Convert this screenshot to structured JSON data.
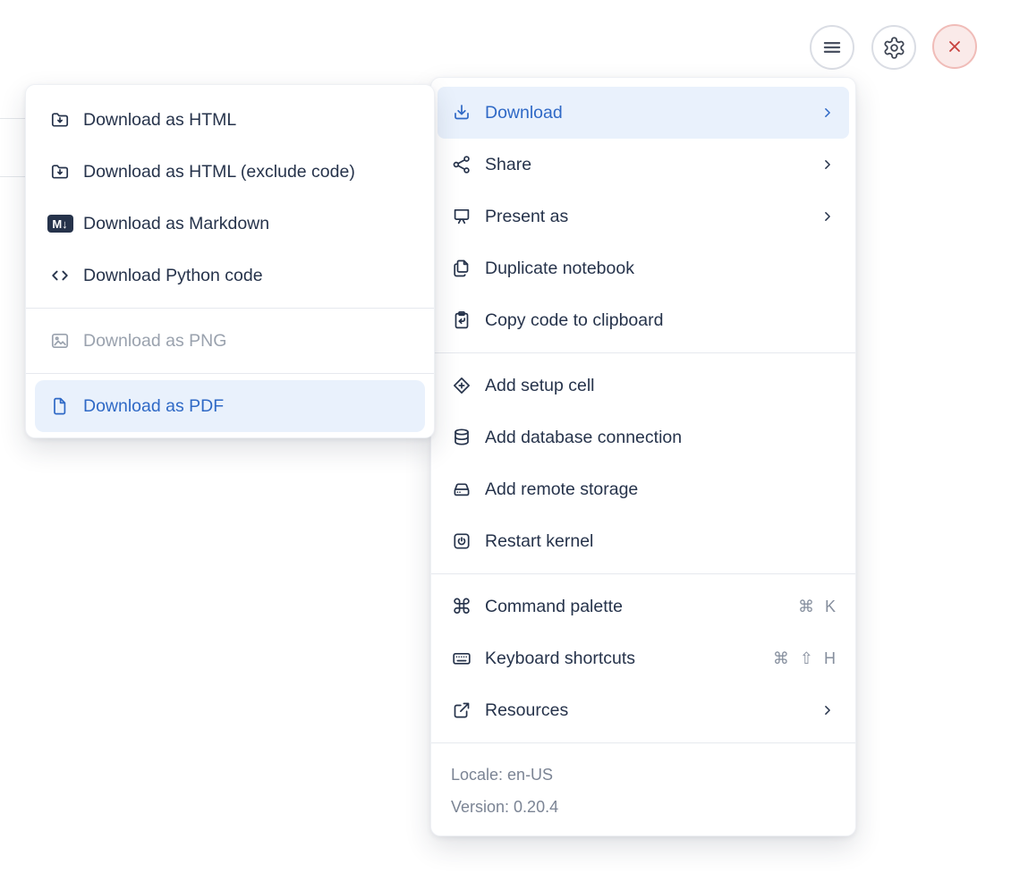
{
  "toolbar": {
    "buttons": [
      {
        "name": "hamburger-menu-button",
        "icon": "hamburger-icon"
      },
      {
        "name": "settings-button",
        "icon": "gear-icon"
      },
      {
        "name": "close-button",
        "icon": "close-icon"
      }
    ]
  },
  "main_menu": {
    "groups": [
      {
        "items": [
          {
            "label": "Download",
            "icon": "download-icon",
            "chevron": true,
            "highlighted": true
          },
          {
            "label": "Share",
            "icon": "share-icon",
            "chevron": true
          },
          {
            "label": "Present as",
            "icon": "presentation-icon",
            "chevron": true
          },
          {
            "label": "Duplicate notebook",
            "icon": "duplicate-icon"
          },
          {
            "label": "Copy code to clipboard",
            "icon": "clipboard-copy-icon"
          }
        ]
      },
      {
        "items": [
          {
            "label": "Add setup cell",
            "icon": "diamond-plus-icon"
          },
          {
            "label": "Add database connection",
            "icon": "database-icon"
          },
          {
            "label": "Add remote storage",
            "icon": "storage-drive-icon"
          },
          {
            "label": "Restart kernel",
            "icon": "power-icon"
          }
        ]
      },
      {
        "items": [
          {
            "label": "Command palette",
            "icon": "command-icon",
            "shortcut": "⌘ K"
          },
          {
            "label": "Keyboard shortcuts",
            "icon": "keyboard-icon",
            "shortcut": "⌘ ⇧ H"
          },
          {
            "label": "Resources",
            "icon": "external-link-icon",
            "chevron": true
          }
        ]
      }
    ],
    "command_glyph": "⌘",
    "footer": {
      "locale": "Locale: en-US",
      "version": "Version: 0.20.4"
    }
  },
  "download_submenu": {
    "groups": [
      {
        "items": [
          {
            "label": "Download as HTML",
            "icon": "folder-download-icon"
          },
          {
            "label": "Download as HTML (exclude code)",
            "icon": "folder-download-icon"
          },
          {
            "label": "Download as Markdown",
            "icon": "markdown-badge-icon"
          },
          {
            "label": "Download Python code",
            "icon": "code-icon"
          }
        ]
      },
      {
        "items": [
          {
            "label": "Download as PNG",
            "icon": "image-icon",
            "disabled": true
          }
        ]
      },
      {
        "items": [
          {
            "label": "Download as PDF",
            "icon": "file-icon",
            "highlighted": true
          }
        ]
      }
    ],
    "markdown_badge_text": "M↓"
  },
  "colors": {
    "accent_blue": "#2f69c6",
    "highlight_bg": "#e9f1fc",
    "text_dark": "#26334b",
    "text_disabled": "#9aa2ae",
    "text_footer": "#7b8494",
    "danger_red": "#c8403c",
    "danger_bg": "#faeae9"
  }
}
